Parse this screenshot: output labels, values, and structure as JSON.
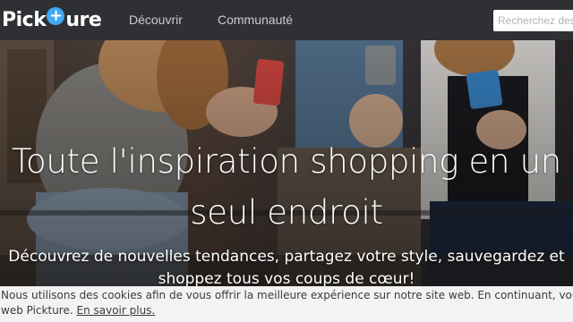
{
  "brand": {
    "name_left": "Pick",
    "name_right": "ure",
    "plus_glyph": "+"
  },
  "nav": {
    "links": [
      {
        "label": "Découvrir"
      },
      {
        "label": "Communauté"
      }
    ],
    "search_placeholder": "Recherchez des"
  },
  "hero": {
    "title_line1": "Toute l'inspiration shopping en un",
    "title_line2": "seul endroit",
    "subtitle_line1": "Découvrez de nouvelles tendances, partagez votre style, sauvegardez et",
    "subtitle_line2": "shoppez tous vos coups de cœur!"
  },
  "cookie": {
    "line1": "Nous utilisons des cookies afin de vous offrir la meilleure expérience sur notre site web. En continuant, vous acceptez",
    "line2_prefix": "web Pickture. ",
    "link_label": "En savoir plus."
  },
  "colors": {
    "navbar": "#2e3033",
    "accent": "#3fa9f5",
    "phone_red": "#e04b45",
    "phone_blue": "#3c8ed6"
  }
}
